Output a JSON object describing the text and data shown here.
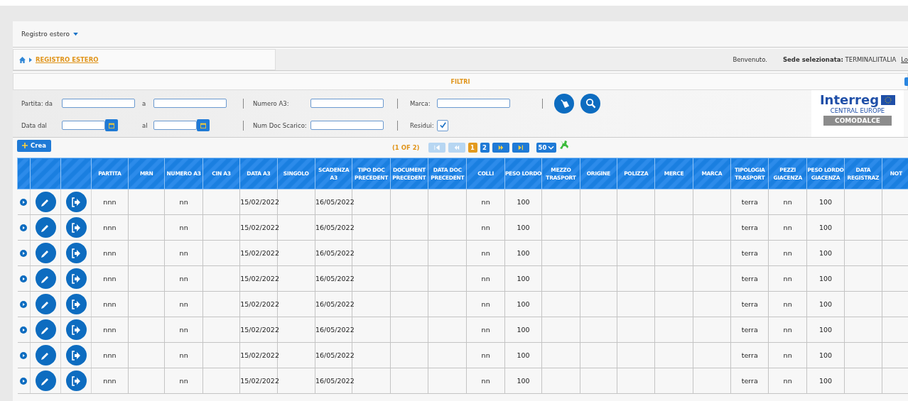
{
  "menu": {
    "label": "Registro estero"
  },
  "breadcrumb": {
    "items": [
      {
        "label": "REGISTRO ESTERO"
      }
    ]
  },
  "header_info": {
    "welcome": "Benvenuto.",
    "site_label": "Sede selezionata:",
    "site_value": "TERMINALIITALIA",
    "link": "Lo"
  },
  "filters": {
    "title": "FILTRI",
    "rows": [
      {
        "groups": [
          [
            {
              "label": "Partita: da",
              "kind": "text"
            },
            {
              "label": "a",
              "kind": "text"
            }
          ],
          [
            {
              "label": "Numero A3:",
              "kind": "text"
            }
          ],
          [
            {
              "label": "Marca:",
              "kind": "text"
            }
          ]
        ]
      },
      {
        "groups": [
          [
            {
              "label": "Data dal",
              "kind": "date"
            },
            {
              "label": "al",
              "kind": "date"
            }
          ],
          [
            {
              "label": "Num Doc Scarico:",
              "kind": "text"
            }
          ],
          [
            {
              "label": "Residui:",
              "kind": "checkbox",
              "checked": true
            }
          ]
        ]
      }
    ],
    "actions": [
      {
        "kind": "clear"
      },
      {
        "kind": "search"
      }
    ]
  },
  "logo": {
    "name": "Interreg",
    "region": "CENTRAL EUROPE",
    "project": "COMODALCE"
  },
  "toolbar": {
    "create": "Crea"
  },
  "pager": {
    "summary": "(1 OF 2)",
    "controls": [
      {
        "kind": "first",
        "disabled": true
      },
      {
        "kind": "prev",
        "disabled": true
      }
    ],
    "pages": [
      {
        "label": "1",
        "selected": true
      },
      {
        "label": "2",
        "selected": false
      }
    ],
    "controls_after": [
      {
        "kind": "next",
        "disabled": false
      },
      {
        "kind": "last",
        "disabled": false
      }
    ],
    "page_size": "50"
  },
  "table": {
    "rows": [
      {
        "expanded": false
      },
      {
        "expanded": false
      },
      {
        "expanded": false
      },
      {
        "expanded": false
      },
      {
        "expanded": false
      },
      {
        "expanded": false
      },
      {
        "expanded": false
      },
      {
        "expanded": false
      }
    ],
    "columns": [
      {
        "label": "PARTITA",
        "values": [
          "nnn",
          "nnn",
          "nnn",
          "nnn",
          "nnn",
          "nnn",
          "nnn",
          "nnn"
        ]
      },
      {
        "label": "MRN"
      },
      {
        "label": "NUMERO A3",
        "values": [
          "nn",
          "nn",
          "nn",
          "nn",
          "nn",
          "nn",
          "nn",
          "nn"
        ]
      },
      {
        "label": "CIN A3"
      },
      {
        "label": "DATA A3",
        "values": [
          "15/02/2022",
          "15/02/2022",
          "15/02/2022",
          "15/02/2022",
          "15/02/2022",
          "15/02/2022",
          "15/02/2022",
          "15/02/2022"
        ]
      },
      {
        "label": "SINGOLO"
      },
      {
        "label": "SCADENZA A3",
        "values": [
          "16/05/2022",
          "16/05/2022",
          "16/05/2022",
          "16/05/2022",
          "16/05/2022",
          "16/05/2022",
          "16/05/2022",
          "16/05/2022"
        ]
      },
      {
        "label": "TIPO DOC PRECEDENT"
      },
      {
        "label": "DOCUMENT PRECEDENT"
      },
      {
        "label": "DATA DOC PRECEDENT"
      },
      {
        "label": "COLLI",
        "values": [
          "nn",
          "nn",
          "nn",
          "nn",
          "nn",
          "nn",
          "nn",
          "nn"
        ]
      },
      {
        "label": "PESO LORDO",
        "values": [
          "100",
          "100",
          "100",
          "100",
          "100",
          "100",
          "100",
          "100"
        ]
      },
      {
        "label": "MEZZO TRASPORT"
      },
      {
        "label": "ORIGINE"
      },
      {
        "label": "POLIZZA"
      },
      {
        "label": "MERCE"
      },
      {
        "label": "MARCA"
      },
      {
        "label": "TIPOLOGIA TRASPORT",
        "values": [
          "terra",
          "terra",
          "terra",
          "terra",
          "terra",
          "terra",
          "terra",
          "terra"
        ]
      },
      {
        "label": "PEZZI GIACENZA",
        "values": [
          "nn",
          "nn",
          "nn",
          "nn",
          "nn",
          "nn",
          "nn",
          "nn"
        ]
      },
      {
        "label": "PESO LORDO GIACENZA",
        "values": [
          "100",
          "100",
          "100",
          "100",
          "100",
          "100",
          "100",
          "100"
        ]
      },
      {
        "label": "DATA REGISTRAZ"
      },
      {
        "label": "NOT"
      }
    ]
  }
}
